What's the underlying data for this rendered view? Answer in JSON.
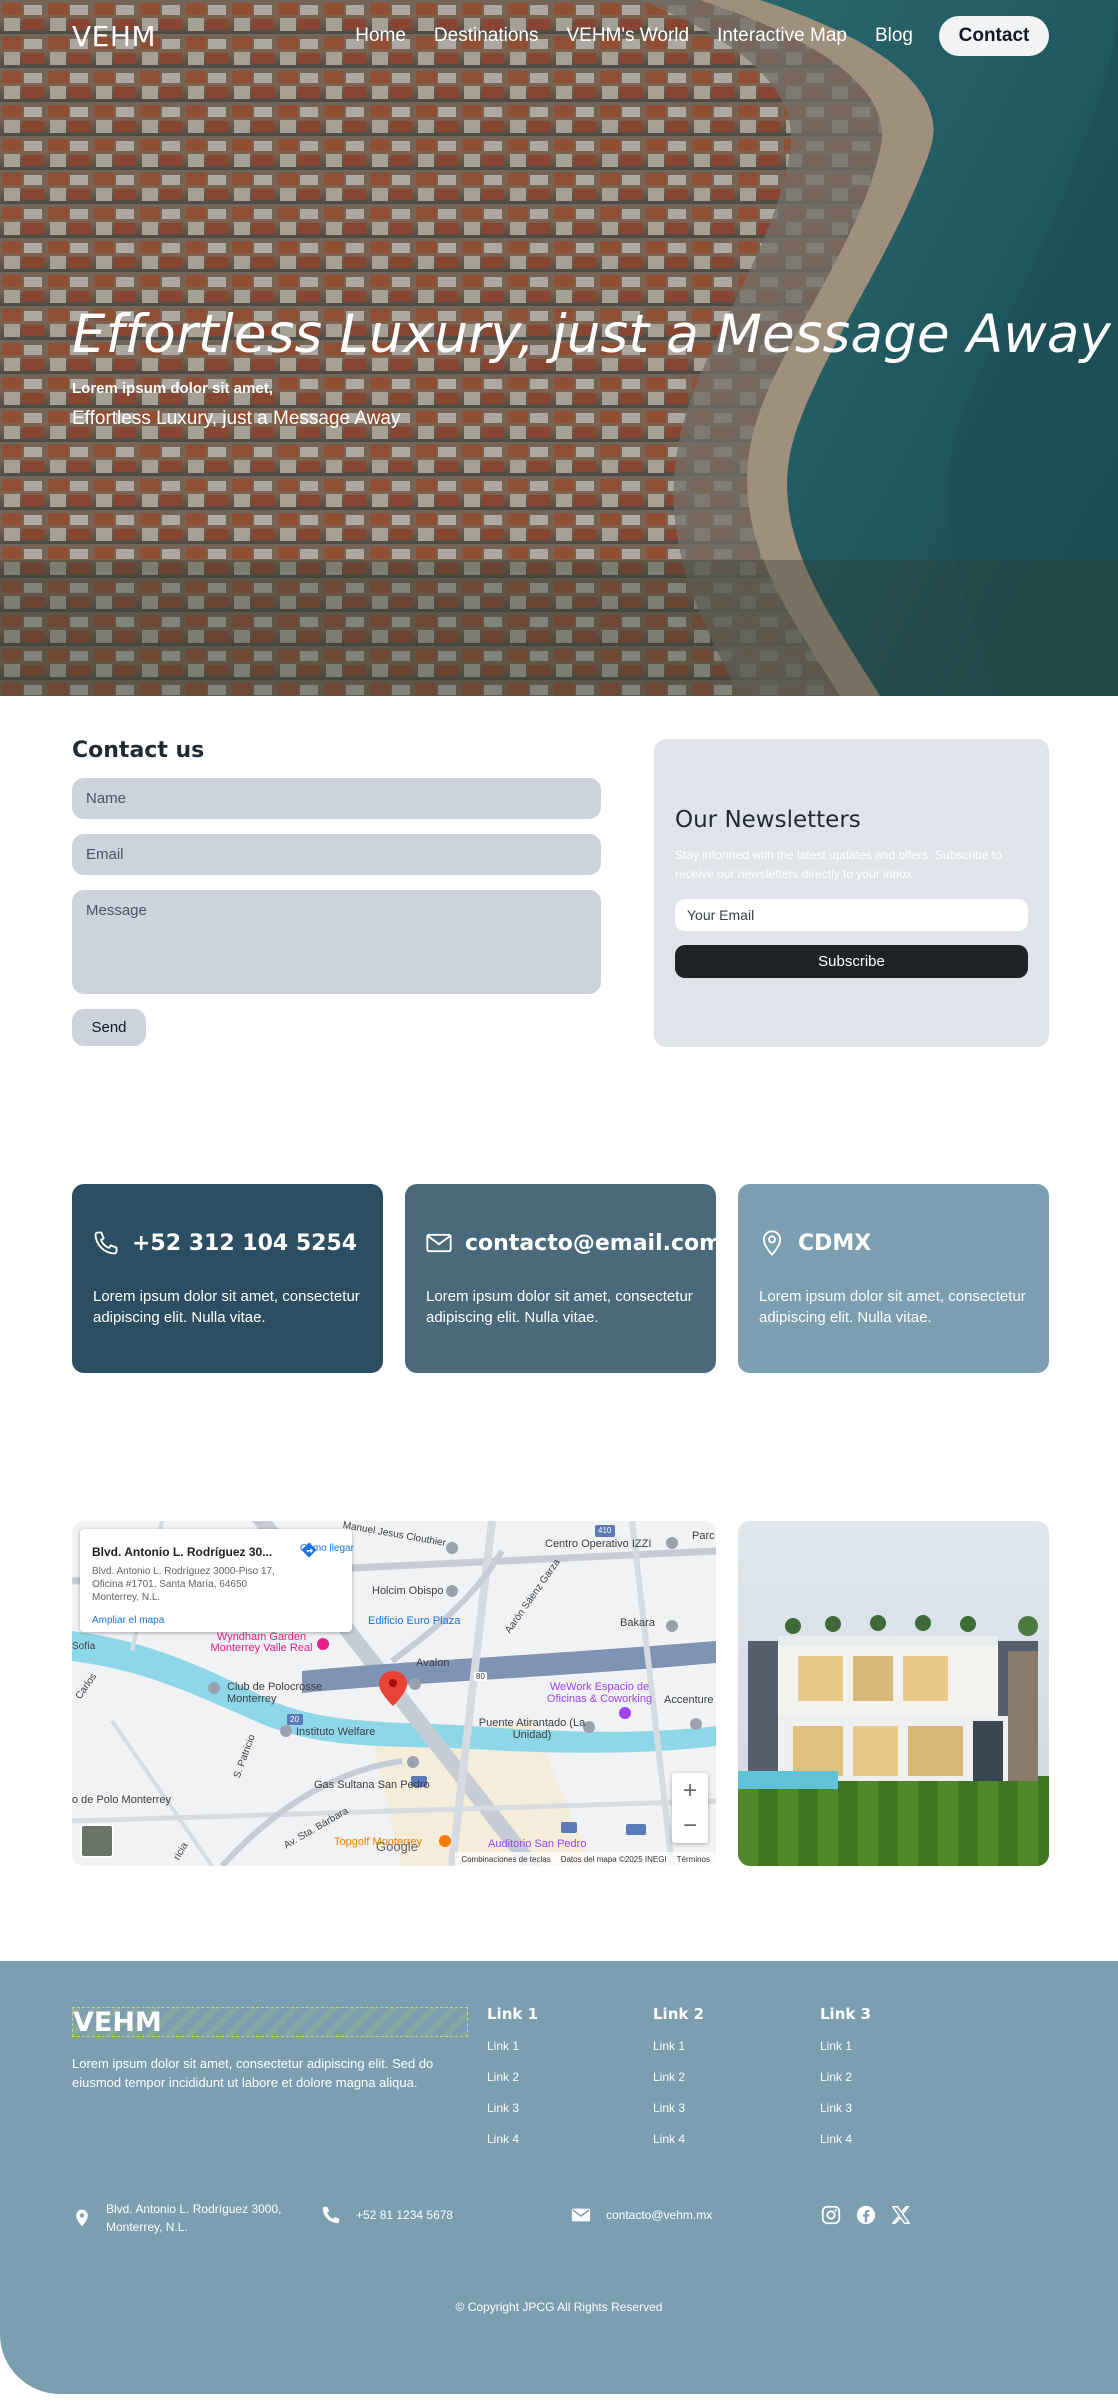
{
  "nav": {
    "logo": "VEHM",
    "links": [
      "Home",
      "Destinations",
      "VEHM's World",
      "Interactive Map",
      "Blog"
    ],
    "contact_button": "Contact"
  },
  "hero": {
    "title": "Effortless Luxury, just a Message Away",
    "subtitle_bold": "Lorem ipsum dolor sit amet,",
    "subtitle": "Effortless Luxury, just a Message Away"
  },
  "contact_form": {
    "title": "Contact us",
    "name_placeholder": "Name",
    "email_placeholder": "Email",
    "message_placeholder": "Message",
    "send_label": "Send"
  },
  "newsletter": {
    "title": "Our Newsletters",
    "text": "Stay informed with the latest updates and offers. Subscribe to receive our newsletters directly to your inbox.",
    "email_placeholder": "Your Email",
    "subscribe_label": "Subscribe"
  },
  "info_cards": [
    {
      "icon": "phone-icon",
      "title": "+52 312 104 5254",
      "text": "Lorem ipsum dolor sit amet, consectetur adipiscing elit. Nulla vitae.",
      "color": "#2c4e62"
    },
    {
      "icon": "mail-icon",
      "title": "contacto@email.com",
      "text": "Lorem ipsum dolor sit amet, consectetur adipiscing elit. Nulla vitae.",
      "color": "#4a6a7c"
    },
    {
      "icon": "location-pin-icon",
      "title": "CDMX",
      "text": "Lorem ipsum dolor sit amet, consectetur adipiscing elit. Nulla vitae.",
      "color": "#7b9eb0"
    }
  ],
  "map": {
    "place_title": "Blvd. Antonio L. Rodríguez 30...",
    "address": "Blvd. Antonio L. Rodríguez 3000-Piso 17, Oficina #1701, Santa María, 64650 Monterrey, N.L.",
    "directions_label": "Cómo llegar",
    "enlarge_label": "Ampliar el mapa",
    "zoom_in": "+",
    "zoom_out": "−",
    "google": "Google",
    "footer": {
      "shortcuts": "Combinaciones de teclas",
      "data": "Datos del mapa ©2025 INEGI",
      "terms": "Términos"
    },
    "labels": {
      "street_top": "Manuel Jesus Clouthier",
      "centro": "Centro Operativo IZZI",
      "parc": "Parc",
      "holcim": "Holcim Obispo",
      "euro_plaza": "Edificio Euro Plaza",
      "saenz": "Aarón Sáenz Garza",
      "bakara": "Bakara",
      "wyndham": "Wyndham Garden Monterrey Valle Real",
      "sofia": "Sofía",
      "avalon": "Avalon",
      "polocrosse": "Club de Polocrosse Monterrey",
      "wework": "WeWork Espacio de Oficinas & Coworking",
      "welfare": "Instituto Welfare",
      "puente": "Puente Atirantado (La Unidad)",
      "accenture": "Accenture",
      "patricio": "S. Patricio",
      "sultana": "Gas Sultana San Pedro",
      "polo_mty": "o de Polo Monterrey",
      "barbara": "Av. Sta. Bárbara",
      "topgolf": "Topgolf Monterrey",
      "auditorio": "Auditorio San Pedro",
      "carlos": "Carlos",
      "ricia": "ricia",
      "shield_410": "410",
      "shield_20": "20",
      "shield_80": "80"
    }
  },
  "footer": {
    "logo": "VEHM",
    "description": "Lorem ipsum dolor sit amet, consectetur adipiscing elit. Sed do eiusmod tempor incididunt ut labore et dolore magna aliqua.",
    "columns": [
      {
        "heading": "Link 1",
        "links": [
          "Link 1",
          "Link 2",
          "Link 3",
          "Link 4"
        ]
      },
      {
        "heading": "Link 2",
        "links": [
          "Link 1",
          "Link 2",
          "Link 3",
          "Link 4"
        ]
      },
      {
        "heading": "Link 3",
        "links": [
          "Link 1",
          "Link 2",
          "Link 3",
          "Link 4"
        ]
      }
    ],
    "address": "Blvd. Antonio L. Rodríguez 3000, Monterrey, N.L.",
    "phone": "+52 81 1234 5678",
    "email": "contacto@vehm.mx",
    "social": [
      "instagram-icon",
      "facebook-icon",
      "x-icon"
    ],
    "copyright": "© Copyright  JPCG  All Rights Reserved"
  }
}
